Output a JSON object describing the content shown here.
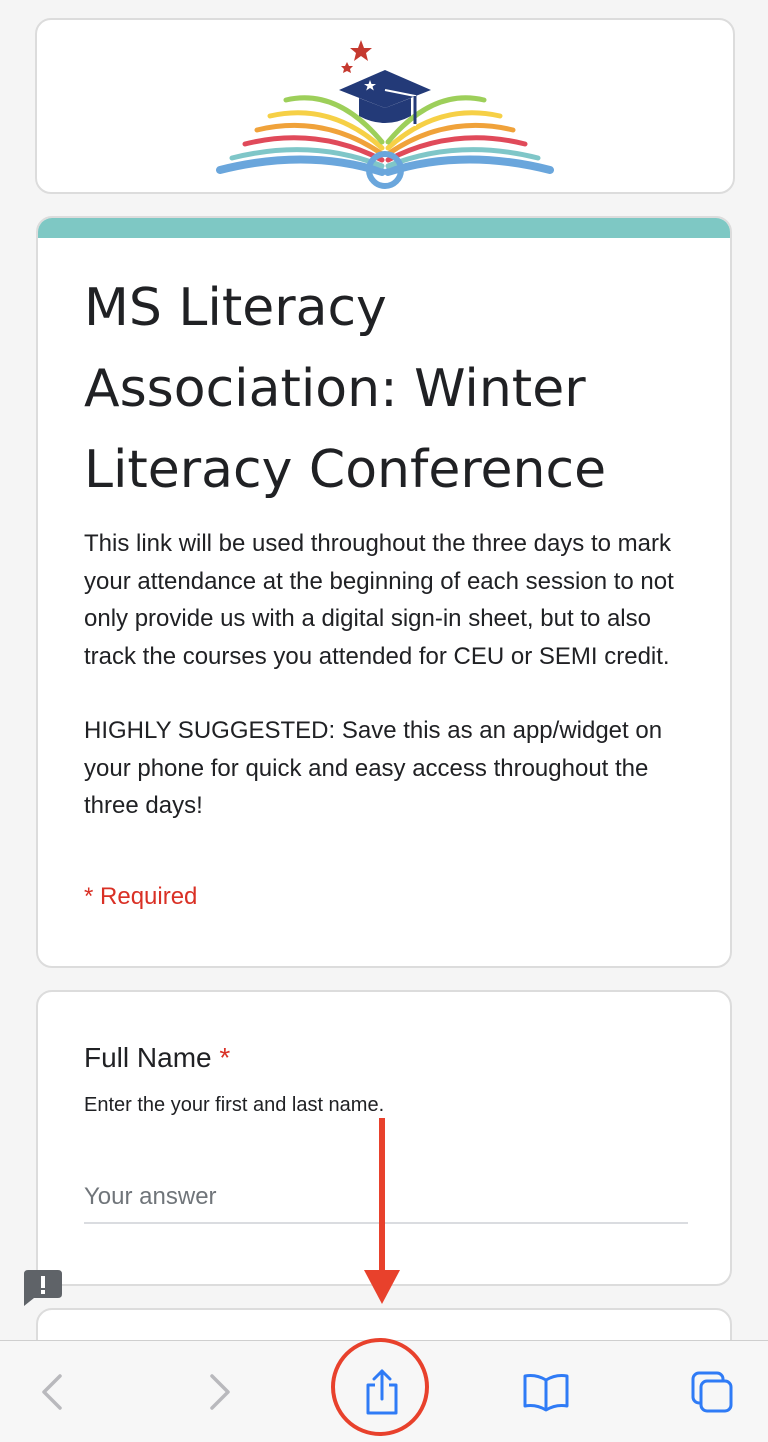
{
  "form": {
    "title": "MS Literacy Association: Winter Literacy Conference",
    "description_paragraphs": [
      "This link will be used throughout the three days to mark your attendance at the beginning of each session to not only provide us with a digital sign-in sheet, but to also track the courses you attended for CEU or SEMI credit.",
      "HIGHLY SUGGESTED: Save this as an app/widget on your phone for quick and easy access throughout the three days!"
    ],
    "required_note": "* Required",
    "accent_color": "#7ec8c4"
  },
  "question": {
    "title": "Full Name",
    "required_marker": "*",
    "help_text": "Enter the your first and last name.",
    "placeholder": "Your answer",
    "value": ""
  },
  "toolbar": {
    "icons": [
      "back-icon",
      "forward-icon",
      "share-icon",
      "bookmarks-icon",
      "tabs-icon"
    ],
    "tint_color": "#2f7bf6",
    "disabled_color": "#b9b9bd"
  },
  "annotation": {
    "color": "#e8412c"
  }
}
